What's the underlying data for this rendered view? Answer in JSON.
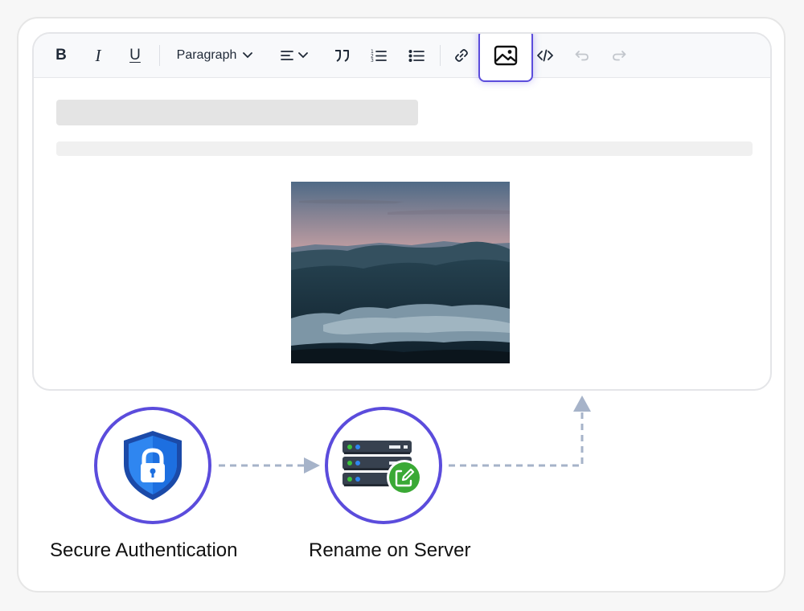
{
  "editor": {
    "toolbar": {
      "bold_label": "B",
      "italic_label": "I",
      "underline_label": "U",
      "block_format": "Paragraph",
      "active_tool": "image"
    },
    "content": {
      "image_icon": "mountain-landscape-photo"
    }
  },
  "flow": {
    "nodes": [
      {
        "label": "Secure Authentication",
        "icon": "shield-lock-icon"
      },
      {
        "label": "Rename on Server",
        "icon": "server-edit-icon"
      }
    ]
  },
  "colors": {
    "accent": "#5b4cdc",
    "connector": "#a6b3c9",
    "shield": "#1d6fe0",
    "edit_badge": "#3aa935"
  }
}
